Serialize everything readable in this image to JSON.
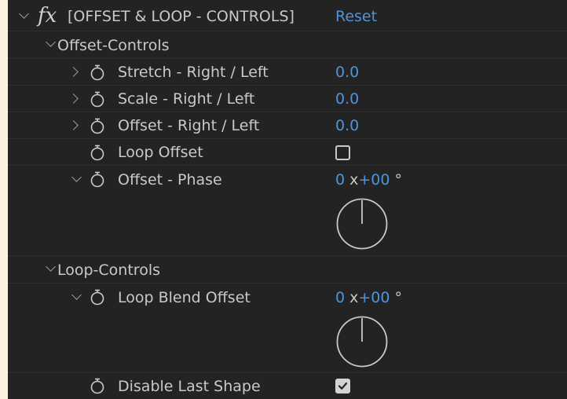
{
  "effect": {
    "fx_symbol": "fx",
    "title": "[OFFSET & LOOP - CONTROLS]",
    "reset_label": "Reset"
  },
  "offset_group": {
    "label": "Offset-Controls",
    "stretch": {
      "label": "Stretch - Right / Left",
      "value": "0.0"
    },
    "scale": {
      "label": "Scale - Right / Left",
      "value": "0.0"
    },
    "offset": {
      "label": "Offset - Right / Left",
      "value": "0.0"
    },
    "loop_offset": {
      "label": "Loop Offset",
      "checked": false
    },
    "phase": {
      "label": "Offset - Phase",
      "revolutions": "0",
      "times": "x",
      "degrees": "+00",
      "unit": "°"
    }
  },
  "loop_group": {
    "label": "Loop-Controls",
    "blend": {
      "label": "Loop Blend Offset",
      "revolutions": "0",
      "times": "x",
      "degrees": "+00",
      "unit": "°"
    },
    "disable_last": {
      "label": "Disable Last Shape",
      "checked": true
    }
  },
  "colors": {
    "panel_bg": "#232323",
    "outer_bg": "#fdf0e0",
    "text": "#c9c9c9",
    "value_blue": "#4e94dc"
  },
  "icons": [
    "chevron-down-icon",
    "chevron-right-icon",
    "stopwatch-icon",
    "fx-icon",
    "angle-dial-icon",
    "checkbox-icon"
  ]
}
